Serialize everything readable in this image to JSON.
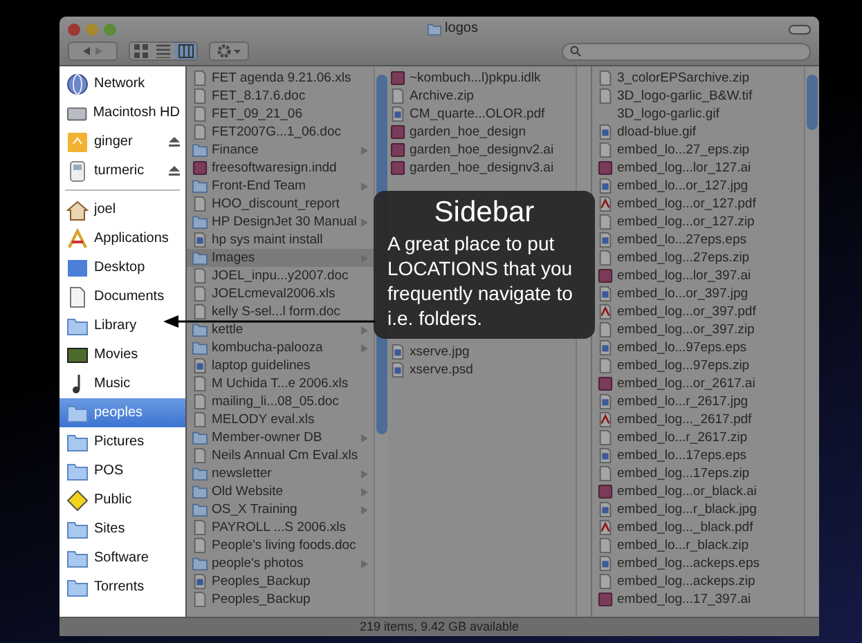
{
  "window": {
    "title": "logos"
  },
  "toolbar": {
    "views": [
      {
        "kind": "icons",
        "selected": false
      },
      {
        "kind": "list",
        "selected": false
      },
      {
        "kind": "columns",
        "selected": true
      }
    ]
  },
  "sidebar": {
    "devices": [
      {
        "label": "Network",
        "kind": "globe",
        "ejectable": false,
        "selected": false
      },
      {
        "label": "Macintosh HD",
        "kind": "disk",
        "ejectable": false,
        "selected": false
      },
      {
        "label": "ginger",
        "kind": "drive",
        "ejectable": true,
        "selected": false
      },
      {
        "label": "turmeric",
        "kind": "ipod",
        "ejectable": true,
        "selected": false
      }
    ],
    "places": [
      {
        "label": "joel",
        "kind": "home",
        "ejectable": false,
        "selected": false
      },
      {
        "label": "Applications",
        "kind": "apps",
        "ejectable": false,
        "selected": false
      },
      {
        "label": "Desktop",
        "kind": "desktop",
        "ejectable": false,
        "selected": false
      },
      {
        "label": "Documents",
        "kind": "document",
        "ejectable": false,
        "selected": false
      },
      {
        "label": "Library",
        "kind": "folder",
        "ejectable": false,
        "selected": false
      },
      {
        "label": "Movies",
        "kind": "film",
        "ejectable": false,
        "selected": false
      },
      {
        "label": "Music",
        "kind": "music",
        "ejectable": false,
        "selected": false
      },
      {
        "label": "peoples",
        "kind": "folder",
        "ejectable": false,
        "selected": true
      },
      {
        "label": "Pictures",
        "kind": "folder",
        "ejectable": false,
        "selected": false
      },
      {
        "label": "POS",
        "kind": "folder",
        "ejectable": false,
        "selected": false
      },
      {
        "label": "Public",
        "kind": "sign",
        "ejectable": false,
        "selected": false
      },
      {
        "label": "Sites",
        "kind": "folder",
        "ejectable": false,
        "selected": false
      },
      {
        "label": "Software",
        "kind": "folder",
        "ejectable": false,
        "selected": false
      },
      {
        "label": "Torrents",
        "kind": "folder",
        "ejectable": false,
        "selected": false
      }
    ]
  },
  "columns": [
    {
      "items": [
        {
          "name": "FET agenda 9.21.06.xls",
          "kind": "file",
          "selected": false
        },
        {
          "name": "FET_8.17.6.doc",
          "kind": "file",
          "selected": false
        },
        {
          "name": "FET_09_21_06",
          "kind": "file",
          "selected": false
        },
        {
          "name": "FET2007G...1_06.doc",
          "kind": "file",
          "selected": false
        },
        {
          "name": "Finance",
          "kind": "folder",
          "selected": false
        },
        {
          "name": "freesoftwaresign.indd",
          "kind": "ai",
          "selected": false
        },
        {
          "name": "Front-End Team",
          "kind": "folder",
          "selected": false
        },
        {
          "name": "HOO_discount_report",
          "kind": "file",
          "selected": false
        },
        {
          "name": "HP DesignJet 30 Manual",
          "kind": "folder",
          "selected": false
        },
        {
          "name": "hp sys maint install",
          "kind": "image",
          "selected": false
        },
        {
          "name": "Images",
          "kind": "folder",
          "selected": true
        },
        {
          "name": "JOEL_inpu...y2007.doc",
          "kind": "file",
          "selected": false
        },
        {
          "name": "JOELcmeval2006.xls",
          "kind": "file",
          "selected": false
        },
        {
          "name": "kelly S-sel...l form.doc",
          "kind": "file",
          "selected": false
        },
        {
          "name": "kettle",
          "kind": "folder",
          "selected": false
        },
        {
          "name": "kombucha-palooza",
          "kind": "folder",
          "selected": false
        },
        {
          "name": "laptop guidelines",
          "kind": "image",
          "selected": false
        },
        {
          "name": "M Uchida T...e 2006.xls",
          "kind": "file",
          "selected": false
        },
        {
          "name": "mailing_li...08_05.doc",
          "kind": "file",
          "selected": false
        },
        {
          "name": "MELODY eval.xls",
          "kind": "file",
          "selected": false
        },
        {
          "name": "Member-owner DB",
          "kind": "folder",
          "selected": false
        },
        {
          "name": "Neils Annual Cm Eval.xls",
          "kind": "file",
          "selected": false
        },
        {
          "name": "newsletter",
          "kind": "folder",
          "selected": false
        },
        {
          "name": "Old Website",
          "kind": "folder",
          "selected": false
        },
        {
          "name": "OS_X Training",
          "kind": "folder",
          "selected": false
        },
        {
          "name": "PAYROLL ...S 2006.xls",
          "kind": "file",
          "selected": false
        },
        {
          "name": "People's living foods.doc",
          "kind": "file",
          "selected": false
        },
        {
          "name": "people's photos",
          "kind": "folder",
          "selected": false
        },
        {
          "name": "Peoples_Backup",
          "kind": "image",
          "selected": false
        },
        {
          "name": "Peoples_Backup",
          "kind": "file",
          "selected": false
        }
      ]
    },
    {
      "items": [
        {
          "name": "~kombuch...l)pkpu.idlk",
          "kind": "ai",
          "selected": false
        },
        {
          "name": "Archive.zip",
          "kind": "file",
          "selected": false
        },
        {
          "name": "CM_quarte...OLOR.pdf",
          "kind": "image",
          "selected": false
        },
        {
          "name": "garden_hoe_design",
          "kind": "ai",
          "selected": false
        },
        {
          "name": "garden_hoe_designv2.ai",
          "kind": "ai",
          "selected": false
        },
        {
          "name": "garden_hoe_designv3.ai",
          "kind": "ai",
          "selected": false
        }
      ],
      "items_after": [
        {
          "name": "xserve.jpg",
          "kind": "image"
        },
        {
          "name": "xserve.psd",
          "kind": "image"
        }
      ]
    },
    {
      "items": [
        {
          "name": "3_colorEPSarchive.zip",
          "kind": "file",
          "selected": false
        },
        {
          "name": "3D_logo-garlic_B&W.tif",
          "kind": "file",
          "selected": false
        },
        {
          "name": "3D_logo-garlic.gif",
          "kind": "none",
          "selected": false
        },
        {
          "name": "dload-blue.gif",
          "kind": "image",
          "selected": false
        },
        {
          "name": "embed_lo...27_eps.zip",
          "kind": "file",
          "selected": false
        },
        {
          "name": "embed_log...lor_127.ai",
          "kind": "ai",
          "selected": false
        },
        {
          "name": "embed_lo...or_127.jpg",
          "kind": "image",
          "selected": false
        },
        {
          "name": "embed_log...or_127.pdf",
          "kind": "pdf",
          "selected": false
        },
        {
          "name": "embed_log...or_127.zip",
          "kind": "file",
          "selected": false
        },
        {
          "name": "embed_lo...27eps.eps",
          "kind": "image",
          "selected": false
        },
        {
          "name": "embed_log...27eps.zip",
          "kind": "file",
          "selected": false
        },
        {
          "name": "embed_log...lor_397.ai",
          "kind": "ai",
          "selected": false
        },
        {
          "name": "embed_lo...or_397.jpg",
          "kind": "image",
          "selected": false
        },
        {
          "name": "embed_log...or_397.pdf",
          "kind": "pdf",
          "selected": false
        },
        {
          "name": "embed_log...or_397.zip",
          "kind": "file",
          "selected": false
        },
        {
          "name": "embed_lo...97eps.eps",
          "kind": "image",
          "selected": false
        },
        {
          "name": "embed_log...97eps.zip",
          "kind": "file",
          "selected": false
        },
        {
          "name": "embed_log...or_2617.ai",
          "kind": "ai",
          "selected": false
        },
        {
          "name": "embed_lo...r_2617.jpg",
          "kind": "image",
          "selected": false
        },
        {
          "name": "embed_log..._2617.pdf",
          "kind": "pdf",
          "selected": false
        },
        {
          "name": "embed_lo...r_2617.zip",
          "kind": "file",
          "selected": false
        },
        {
          "name": "embed_lo...17eps.eps",
          "kind": "image",
          "selected": false
        },
        {
          "name": "embed_log...17eps.zip",
          "kind": "file",
          "selected": false
        },
        {
          "name": "embed_log...or_black.ai",
          "kind": "ai",
          "selected": false
        },
        {
          "name": "embed_log...r_black.jpg",
          "kind": "image",
          "selected": false
        },
        {
          "name": "embed_log..._black.pdf",
          "kind": "pdf",
          "selected": false
        },
        {
          "name": "embed_lo...r_black.zip",
          "kind": "file",
          "selected": false
        },
        {
          "name": "embed_log...ackeps.eps",
          "kind": "image",
          "selected": false
        },
        {
          "name": "embed_log...ackeps.zip",
          "kind": "file",
          "selected": false
        },
        {
          "name": "embed_log...17_397.ai",
          "kind": "ai",
          "selected": false
        }
      ]
    }
  ],
  "status_bar": "219 items, 9.42 GB available",
  "callout": {
    "title": "Sidebar",
    "body": "A great place to put LOCATIONS that you frequently navigate to i.e. folders."
  }
}
